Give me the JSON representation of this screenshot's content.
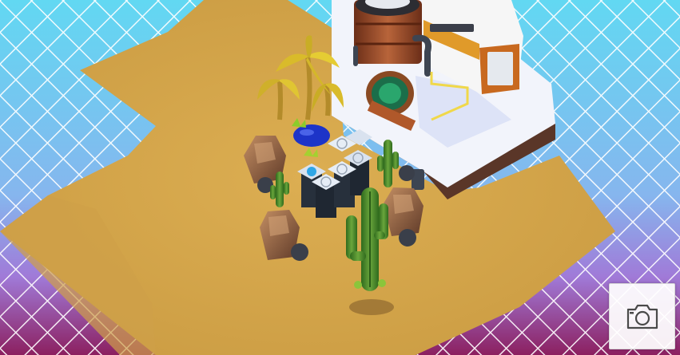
{
  "scene": {
    "background_top": "#62d8f2",
    "background_mid": "#9a7ee0",
    "background_bottom": "#8c2060",
    "grid_line_color": "#ffffff",
    "ground_color": "#d8a94e",
    "ground_dark": "#a98235",
    "building_color": "#f2f4fb",
    "building_side": "#5a3628",
    "cactus_color": "#4d8f2f",
    "palm_color": "#e1c42e",
    "rock_color": "#8a5b40",
    "pond_color": "#1d34c8",
    "tank_color": "#a4502c",
    "machine_accent": "#e09a2a",
    "pipe_color": "#3d4552",
    "planter_color": "#d9e2ef"
  },
  "toolbar": {
    "camera_icon": "camera-icon"
  }
}
